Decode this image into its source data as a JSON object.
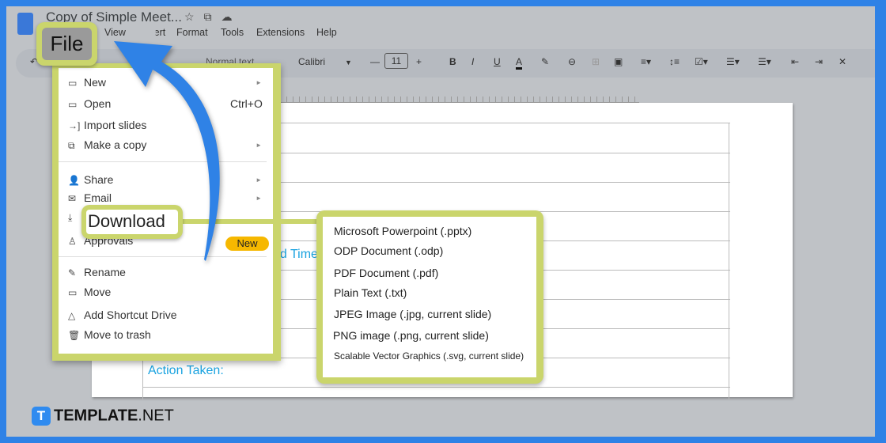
{
  "doc": {
    "title": "Copy of Simple Meet...",
    "menus": [
      "File",
      "View",
      "Insert",
      "Format",
      "Tools",
      "Extensions",
      "Help"
    ]
  },
  "toolbar": {
    "style": "Normal text",
    "font": "Calibri",
    "size": "11",
    "bold": "B",
    "italic": "I",
    "underline": "U",
    "color": "A"
  },
  "document": {
    "partial_label": "nd Time",
    "action_label": "Action Taken:"
  },
  "callouts": {
    "file": "File",
    "download": "Download"
  },
  "file_menu": {
    "items": [
      {
        "label": "New",
        "icon": "new-window-icon",
        "submenu": true
      },
      {
        "label": "Open",
        "icon": "folder-icon",
        "shortcut": "Ctrl+O"
      },
      {
        "label": "Import slides",
        "icon": "import-icon"
      },
      {
        "label": "Make a copy",
        "icon": "copy-icon",
        "submenu": true
      },
      {
        "label": "Share",
        "icon": "person-add-icon",
        "submenu": true
      },
      {
        "label": "Email",
        "icon": "mail-icon",
        "submenu": true
      },
      {
        "label": "Download",
        "icon": "download-icon",
        "submenu": true
      },
      {
        "label": "Approvals",
        "icon": "stamp-icon",
        "badge": "New"
      },
      {
        "label": "Rename",
        "icon": "pencil-icon"
      },
      {
        "label": "Move",
        "icon": "move-folder-icon"
      },
      {
        "label": "Add Shortcut Drive",
        "icon": "drive-shortcut-icon"
      },
      {
        "label": "Move to trash",
        "icon": "trash-icon"
      }
    ]
  },
  "download_menu": [
    "Microsoft Powerpoint (.pptx)",
    "ODP Document (.odp)",
    "PDF Document (.pdf)",
    "Plain Text (.txt)",
    "JPEG Image (.jpg, current slide)",
    "PNG image (.png, current slide)",
    "Scalable Vector Graphics (.svg, current slide)"
  ],
  "brand": {
    "logo_letter": "T",
    "name": "TEMPLATE",
    "suffix": ".NET"
  },
  "colors": {
    "highlight": "#cad56c",
    "arrow": "#2f82e6",
    "accent_text": "#1aa3e0",
    "badge": "#f6b800"
  }
}
